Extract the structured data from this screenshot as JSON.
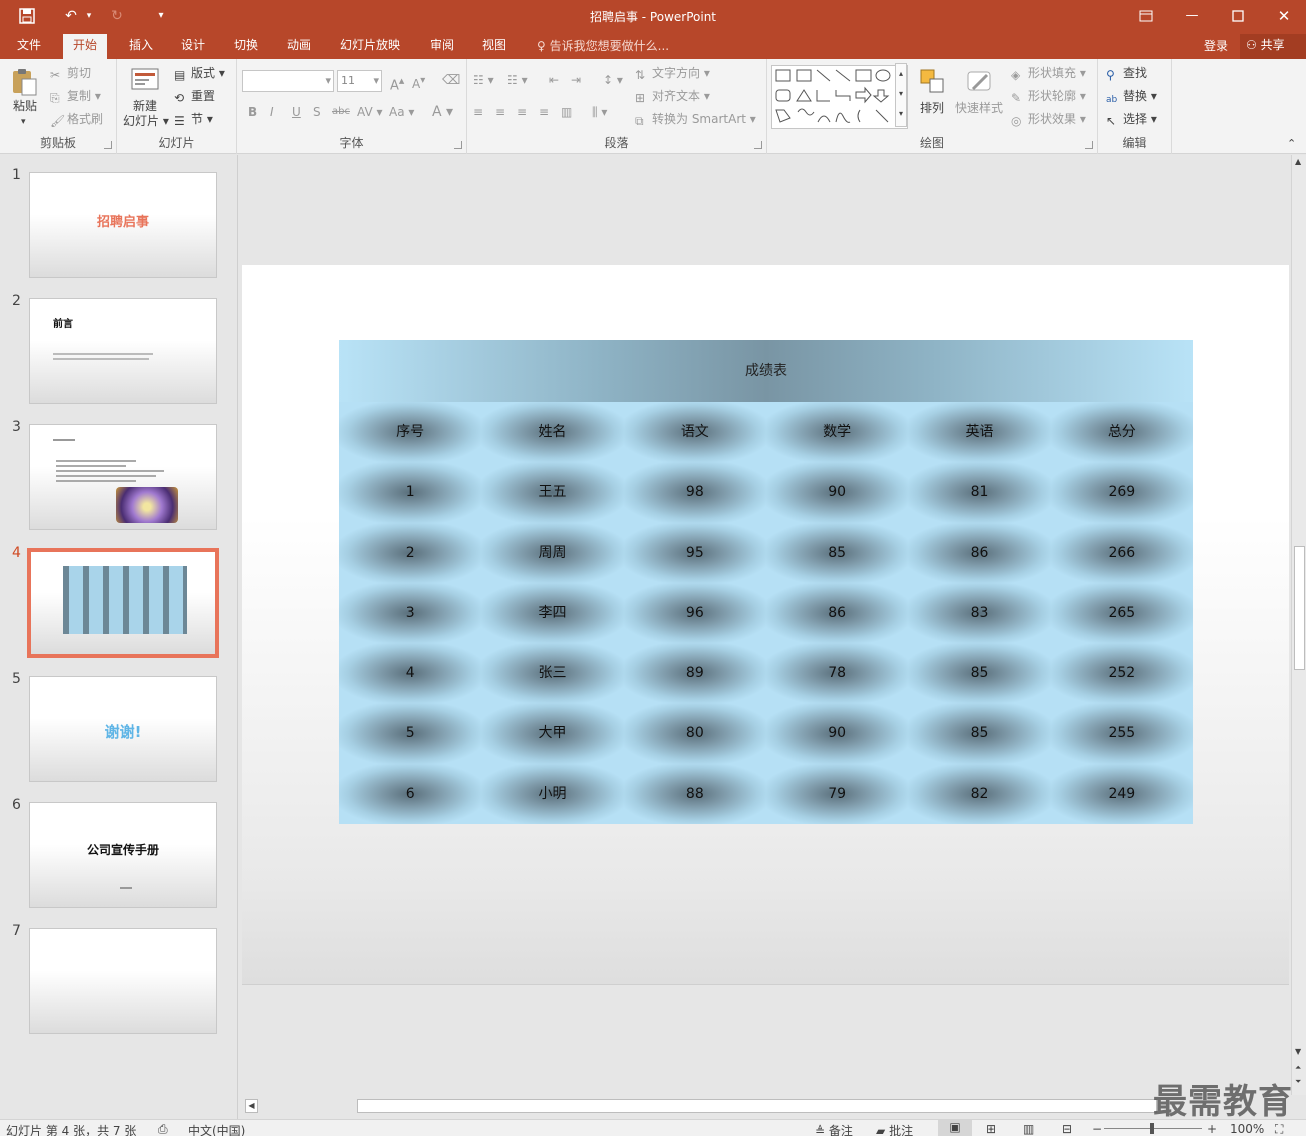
{
  "window": {
    "title": "招聘启事 - PowerPoint"
  },
  "tabs": [
    {
      "label": "文件"
    },
    {
      "label": "开始"
    },
    {
      "label": "插入"
    },
    {
      "label": "设计"
    },
    {
      "label": "切换"
    },
    {
      "label": "动画"
    },
    {
      "label": "幻灯片放映"
    },
    {
      "label": "审阅"
    },
    {
      "label": "视图"
    }
  ],
  "tell_me": "告诉我您想要做什么...",
  "login": "登录",
  "share": "共享",
  "ribbon": {
    "clipboard": {
      "paste": "粘贴",
      "cut": "剪切",
      "copy": "复制",
      "format_painter": "格式刷",
      "label": "剪贴板"
    },
    "slides": {
      "new_slide": "新建",
      "new_slide2": "幻灯片",
      "layout": "版式",
      "reset": "重置",
      "section": "节",
      "label": "幻灯片"
    },
    "font": {
      "size": "11",
      "label": "字体"
    },
    "paragraph": {
      "text_direction": "文字方向",
      "align_text": "对齐文本",
      "convert_smartart": "转换为 SmartArt",
      "label": "段落"
    },
    "drawing": {
      "arrange": "排列",
      "quick_styles": "快速样式",
      "shape_fill": "形状填充",
      "shape_outline": "形状轮廓",
      "shape_effects": "形状效果",
      "label": "绘图"
    },
    "editing": {
      "find": "查找",
      "replace": "替换",
      "select": "选择",
      "label": "编辑"
    }
  },
  "thumbnails": [
    {
      "num": "1",
      "text": "招聘启事"
    },
    {
      "num": "2",
      "text": "前言"
    },
    {
      "num": "3",
      "text": ""
    },
    {
      "num": "4",
      "text": ""
    },
    {
      "num": "5",
      "text": "谢谢!"
    },
    {
      "num": "6",
      "text": "公司宣传手册"
    },
    {
      "num": "7",
      "text": ""
    }
  ],
  "slide": {
    "table_title": "成绩表",
    "headers": [
      "序号",
      "姓名",
      "语文",
      "数学",
      "英语",
      "总分"
    ],
    "rows": [
      [
        "1",
        "王五",
        "98",
        "90",
        "81",
        "269"
      ],
      [
        "2",
        "周周",
        "95",
        "85",
        "86",
        "266"
      ],
      [
        "3",
        "李四",
        "96",
        "86",
        "83",
        "265"
      ],
      [
        "4",
        "张三",
        "89",
        "78",
        "85",
        "252"
      ],
      [
        "5",
        "大甲",
        "80",
        "90",
        "85",
        "255"
      ],
      [
        "6",
        "小明",
        "88",
        "79",
        "82",
        "249"
      ]
    ]
  },
  "status": {
    "slide_info": "幻灯片 第 4 张，共 7 张",
    "language": "中文(中国)",
    "notes": "备注",
    "comments": "批注",
    "zoom": "100%"
  },
  "watermark": "最需教育",
  "colors": {
    "accent": "#b7472a",
    "selected_thumb": "#e8745a"
  }
}
